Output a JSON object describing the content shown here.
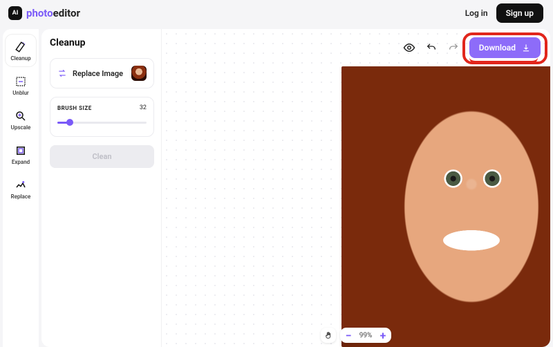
{
  "brand": {
    "badge": "AI",
    "part1": "photo",
    "part2": "editor"
  },
  "auth": {
    "login": "Log in",
    "signup": "Sign up"
  },
  "sidebar": {
    "items": [
      {
        "label": "Cleanup"
      },
      {
        "label": "Unblur"
      },
      {
        "label": "Upscale"
      },
      {
        "label": "Expand"
      },
      {
        "label": "Replace"
      }
    ]
  },
  "panel": {
    "title": "Cleanup",
    "replace_label": "Replace Image",
    "brush_label": "BRUSH SIZE",
    "brush_value": "32",
    "clean_label": "Clean"
  },
  "toolbar": {
    "download_label": "Download"
  },
  "zoom": {
    "value": "99%"
  },
  "colors": {
    "accent": "#7a5af8",
    "annot": "#e1261c"
  }
}
